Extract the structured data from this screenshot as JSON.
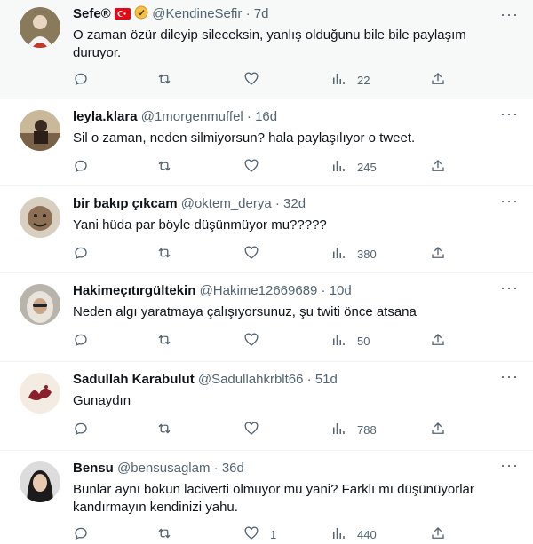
{
  "tweets": [
    {
      "name": "Sefe®",
      "handle": "@KendineSefir",
      "age": "7d",
      "lines": [
        "O zaman özür dileyip sileceksin, yanlış olduğunu bile bile paylaşım",
        "duruyor."
      ],
      "replies": "",
      "retweets": "",
      "likes": "",
      "views": "22"
    },
    {
      "name": "leyla.klara",
      "handle": "@1morgenmuffel",
      "age": "16d",
      "lines": [
        "Sil o zaman, neden silmiyorsun? hala paylaşılıyor o tweet."
      ],
      "replies": "",
      "retweets": "",
      "likes": "",
      "views": "245"
    },
    {
      "name": "bir bakıp çıkcam",
      "handle": "@oktem_derya",
      "age": "32d",
      "lines": [
        "Yani hüda par böyle düşünmüyor mu?????"
      ],
      "replies": "",
      "retweets": "",
      "likes": "",
      "views": "380"
    },
    {
      "name": "Hakimeçıtırgültekin",
      "handle": "@Hakime12669689",
      "age": "10d",
      "lines": [
        "Neden algı yaratmaya çalışıyorsunuz, şu twiti önce atsana"
      ],
      "replies": "",
      "retweets": "",
      "likes": "",
      "views": "50"
    },
    {
      "name": "Sadullah Karabulut",
      "handle": "@Sadullahkrblt66",
      "age": "51d",
      "lines": [
        "Gunaydın"
      ],
      "replies": "",
      "retweets": "",
      "likes": "",
      "views": "788"
    },
    {
      "name": "Bensu",
      "handle": "@bensusaglam",
      "age": "36d",
      "lines": [
        "Bunlar aynı bokun laciverti olmuyor mu yani? Farklı mı düşünüyorlar",
        "kandırmayın kendinizi yahu."
      ],
      "replies": "",
      "retweets": "",
      "likes": "1",
      "views": "440"
    }
  ],
  "separator": "·",
  "more_label": "···",
  "colors": {
    "text": "#0f1419",
    "secondary": "#536471",
    "divider": "#eff3f4",
    "first_bg": "#f7f9f9"
  },
  "icons": [
    "reply-icon",
    "retweet-icon",
    "like-icon",
    "views-icon",
    "share-icon",
    "more-icon",
    "turkey-flag-icon",
    "verified-badge-icon"
  ]
}
